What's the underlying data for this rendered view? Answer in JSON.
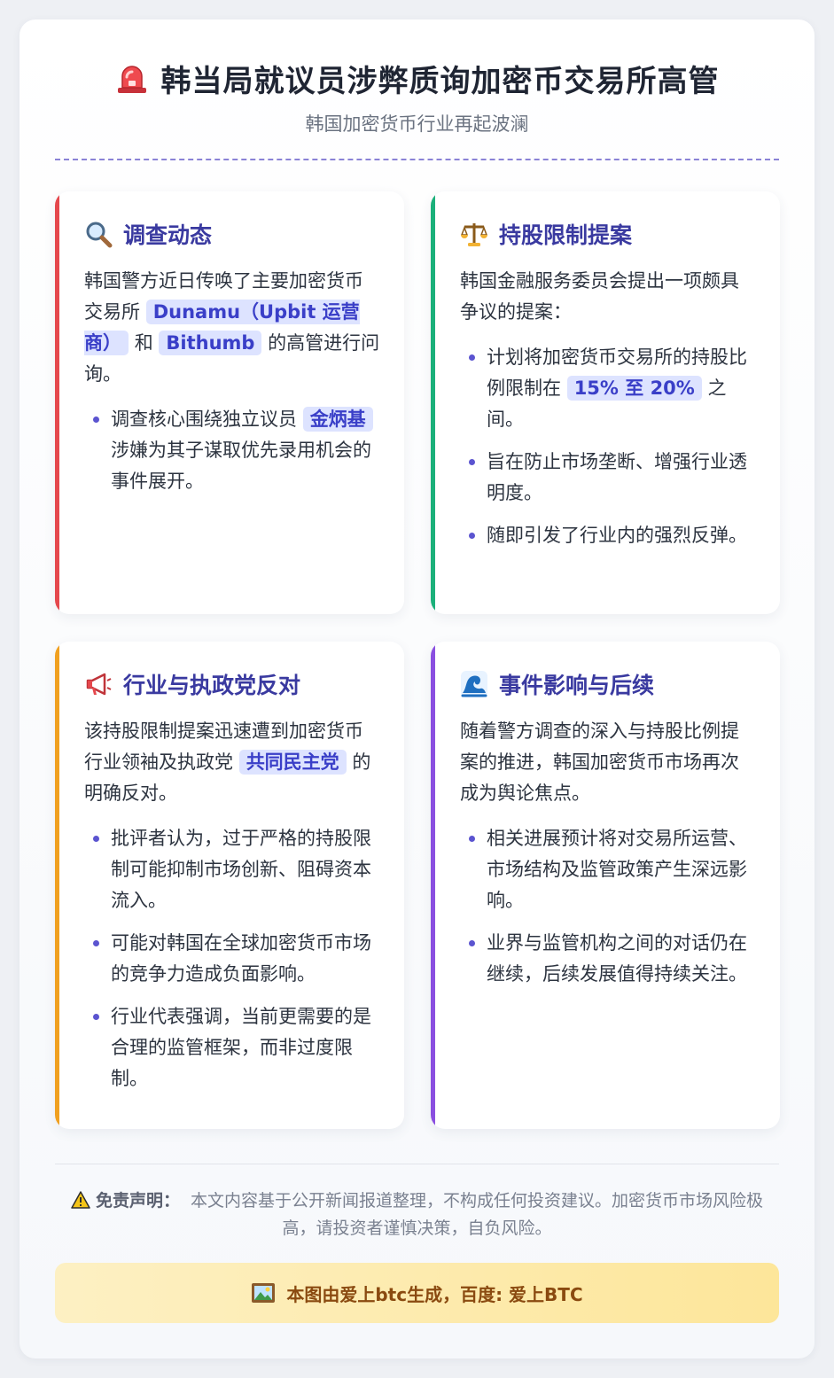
{
  "header": {
    "title": "韩当局就议员涉弊质询加密币交易所高管",
    "subtitle": "韩国加密货币行业再起波澜",
    "title_icon": "siren-icon"
  },
  "cards": {
    "investigation": {
      "icon": "magnifier-icon",
      "title": "调查动态",
      "accent": "#e5484d",
      "p_1": "韩国警方近日传唤了主要加密货币交易所",
      "hl_1": "Dunamu（Upbit 运营商）",
      "p_2": "和",
      "hl_2": "Bithumb",
      "p_3": "的高管进行问询。",
      "b1_1": "调查核心围绕独立议员",
      "b1_hl": "金炳基",
      "b1_2": "涉嫌为其子谋取优先录用机会的事件展开。"
    },
    "proposal": {
      "icon": "scales-icon",
      "title": "持股限制提案",
      "accent": "#1bb07a",
      "p": "韩国金融服务委员会提出一项颇具争议的提案：",
      "b1_1": "计划将加密货币交易所的持股比例限制在",
      "b1_hl": "15% 至 20%",
      "b1_2": "之间。",
      "b2": "旨在防止市场垄断、增强行业透明度。",
      "b3": "随即引发了行业内的强烈反弹。"
    },
    "opposition": {
      "icon": "megaphone-icon",
      "title": "行业与执政党反对",
      "accent": "#f0a020",
      "p_1": "该持股限制提案迅速遭到加密货币行业领袖及执政党",
      "hl": "共同民主党",
      "p_2": "的明确反对。",
      "b1": "批评者认为，过于严格的持股限制可能抑制市场创新、阻碍资本流入。",
      "b2": "可能对韩国在全球加密货币市场的竞争力造成负面影响。",
      "b3": "行业代表强调，当前更需要的是合理的监管框架，而非过度限制。"
    },
    "impact": {
      "icon": "wave-icon",
      "title": "事件影响与后续",
      "accent": "#8a4fe0",
      "p": "随着警方调查的深入与持股比例提案的推进，韩国加密货币市场再次成为舆论焦点。",
      "b1": "相关进展预计将对交易所运营、市场结构及监管政策产生深远影响。",
      "b2": "业界与监管机构之间的对话仍在继续，后续发展值得持续关注。"
    }
  },
  "footer": {
    "disclaimer_label": "免责声明：",
    "disclaimer_text": "本文内容基于公开新闻报道整理，不构成任何投资建议。加密货币市场风险极高，请投资者谨慎决策，自负风险。",
    "warning_icon": "warning-icon",
    "banner_text": "本图由爱上btc生成，百度: 爱上BTC",
    "banner_icon": "picture-icon"
  }
}
